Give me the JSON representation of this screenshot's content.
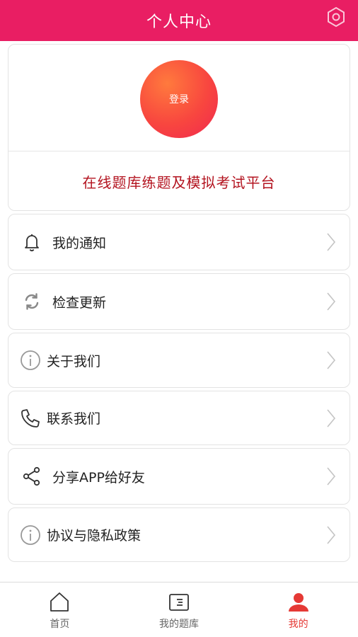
{
  "header": {
    "title": "个人中心",
    "settings_icon": "settings-hex-icon"
  },
  "profile": {
    "login_label": "登录",
    "slogan": "在线题库练题及模拟考试平台"
  },
  "menu": [
    {
      "label": "我的通知",
      "icon": "bell-icon"
    },
    {
      "label": "检查更新",
      "icon": "refresh-icon"
    },
    {
      "label": "关于我们",
      "icon": "info-icon"
    },
    {
      "label": "联系我们",
      "icon": "phone-icon"
    },
    {
      "label": "分享APP给好友",
      "icon": "share-icon"
    },
    {
      "label": "协议与隐私政策",
      "icon": "info-icon"
    }
  ],
  "tabs": [
    {
      "label": "首页",
      "icon": "home-icon",
      "active": false
    },
    {
      "label": "我的题库",
      "icon": "question-bank-icon",
      "active": false
    },
    {
      "label": "我的",
      "icon": "user-icon",
      "active": true
    }
  ],
  "colors": {
    "brand": "#e91e63",
    "slogan": "#b3131f",
    "active_tab": "#e53935"
  }
}
